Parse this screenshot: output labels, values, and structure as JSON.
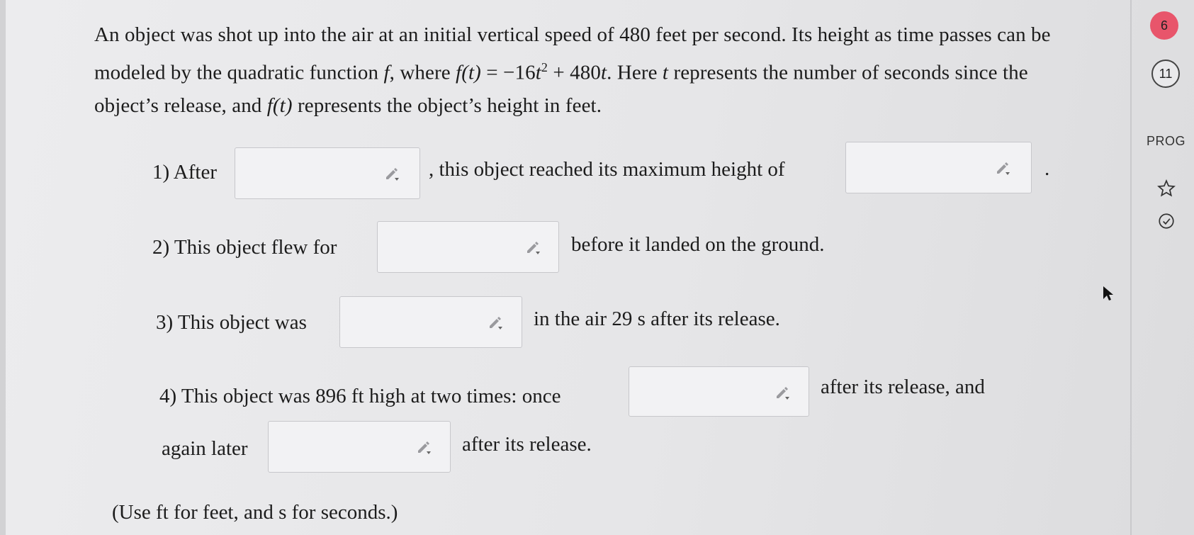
{
  "problem": {
    "intro": "An object was shot up into the air at an initial vertical speed of 480 feet per second. Its height as time passes can be modeled by the quadratic function f, where f(t) = −16t² + 480t. Here t represents the number of seconds since the object’s release, and f(t) represents the object’s height in feet.",
    "intro_parts": {
      "a": "An object was shot up into the air at an initial vertical speed of 480 feet per second. Its height as time passes can be modeled by the quadratic function ",
      "f1": "f",
      "b": ", where ",
      "ft1": "f(t)",
      "c": " = −16",
      "t1": "t",
      "sup": "2",
      "d": " + 480",
      "t2": "t",
      "e": ". Here ",
      "t3": "t",
      "g": " represents the number of seconds since the object’s release, and ",
      "ft2": "f(t)",
      "h": " represents the object’s height in feet."
    }
  },
  "questions": {
    "q1": {
      "prefix": "1) After",
      "middle": ", this object reached its maximum height of",
      "suffix": ".",
      "input1_value": "",
      "input2_value": ""
    },
    "q2": {
      "prefix": "2) This object flew for",
      "suffix": "before it landed on the ground.",
      "input_value": ""
    },
    "q3": {
      "prefix": "3) This object was",
      "suffix": "in the air 29 s after its release.",
      "input_value": ""
    },
    "q4": {
      "prefix": "4) This object was 896 ft high at two times: once",
      "middle": "after its release, and",
      "line2_prefix": "again later",
      "suffix": "after its release.",
      "input1_value": "",
      "input2_value": ""
    }
  },
  "note": "(Use ft for feet, and s for seconds.)",
  "sidebar": {
    "active_question": "6",
    "next_question": "11",
    "progress_label": "PROG",
    "icons": [
      "star-icon",
      "check-circle-icon"
    ],
    "active_color": "#e8556b"
  }
}
